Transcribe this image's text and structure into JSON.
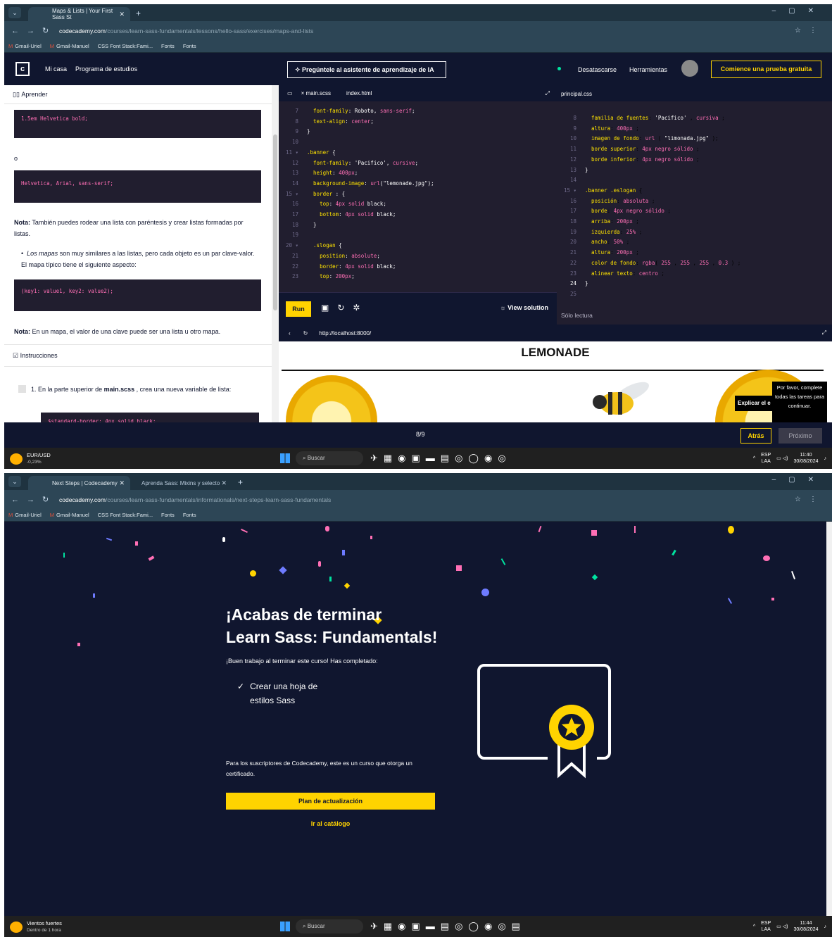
{
  "s1": {
    "tabs": [
      {
        "label": "Maps & Lists | Your First Sass St"
      }
    ],
    "url": {
      "host": "codecademy.com",
      "path": "/courses/learn-sass-fundamentals/lessons/hello-sass/exercises/maps-and-lists"
    },
    "bookmarks": [
      "Gmail-Uriel",
      "Gmail-Manuel",
      "CSS Font Stack:Fami...",
      "Fonts",
      "Fonts"
    ],
    "header": {
      "logo": "c",
      "nav": [
        "Mi casa",
        "Programa de estudios"
      ],
      "ai_button": "Pregúntele al asistente de aprendizaje de IA",
      "right": [
        "Desatascarse",
        "Herramientas"
      ],
      "trial_button": "Comience una prueba gratuita"
    },
    "learn": {
      "heading": "Aprender",
      "code1": "1.5em Helvetica bold;",
      "or": "o",
      "code2": "Helvetica, Arial, sans-serif;",
      "note1_bold": "Nota:",
      "note1": " También puedes rodear una lista con paréntesis y crear listas formadas por listas.",
      "bullet_italic": "Los mapas",
      "bullet": " son muy similares a las listas, pero cada objeto es un par clave-valor. El mapa típico tiene el siguiente aspecto:",
      "code3": "(key1: value1, key2: value2);",
      "note2_bold": "Nota:",
      "note2": " En un mapa, el valor de una clave puede ser una lista u otro mapa.",
      "instructions_heading": "Instrucciones",
      "task_num": "1.",
      "task_pre": "En la parte superior de ",
      "task_file": "main.scss",
      "task_post": " , crea una nueva variable de lista:",
      "task_code": "$standard-border: 4px solid black;"
    },
    "editor": {
      "tabs": [
        "main.scss",
        "index.html"
      ],
      "run": "Run",
      "view_solution": "View solution"
    },
    "readonly": {
      "tab": "principal.css",
      "footer": "Sólo lectura"
    },
    "preview": {
      "url": "http://localhost:8000/",
      "heading": "LEMONADE",
      "explain": "Explicar el e",
      "tooltip": "Por favor, complete todas las tareas para continuar."
    },
    "footer": {
      "pager": "8/9",
      "back": "Atrás",
      "next": "Próximo"
    },
    "taskbar": {
      "widget": "EUR/USD",
      "widget_sub": "-0,23%",
      "search": "Buscar",
      "lang": "ESP",
      "lang2": "LAA",
      "time": "11:40",
      "date": "30/08/2024"
    }
  },
  "s2": {
    "tabs": [
      {
        "label": "Next Steps | Codecademy"
      },
      {
        "label": "Aprenda Sass: Mixins y selecto"
      }
    ],
    "url": {
      "host": "codecademy.com",
      "path": "/courses/learn-sass-fundamentals/informationals/next-steps-learn-sass-fundamentals"
    },
    "bookmarks": [
      "Gmail-Uriel",
      "Gmail-Manuel",
      "CSS Font Stack:Fami...",
      "Fonts",
      "Fonts"
    ],
    "hero": {
      "line1": "¡Acabas de terminar",
      "line2": "Learn Sass: Fundamentals!",
      "subtitle": "¡Buen trabajo al terminar este curso! Has completado:",
      "completed": "Crear una hoja de estilos Sass",
      "cert_text": "Para los suscriptores de Codecademy, este es un curso que otorga un certificado.",
      "upgrade": "Plan de actualización",
      "catalog": "Ir al catálogo"
    },
    "taskbar": {
      "widget": "Vientos fuertes",
      "widget_sub": "Dentro de 1 hora",
      "search": "Buscar",
      "lang": "ESP",
      "lang2": "LAA",
      "time": "11:44",
      "date": "30/08/2024"
    }
  }
}
